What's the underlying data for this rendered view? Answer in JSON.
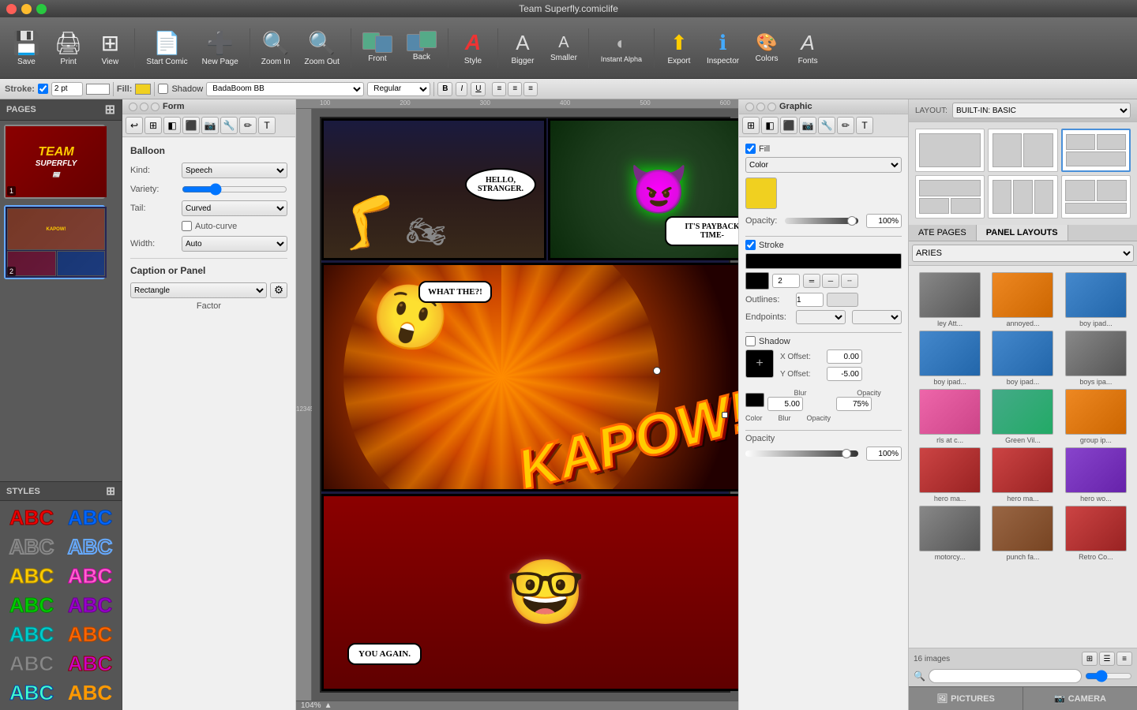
{
  "window": {
    "title": "Team Superfly.comiclife",
    "close": "×",
    "minimize": "−",
    "maximize": "+"
  },
  "toolbar": {
    "save_label": "Save",
    "print_label": "Print",
    "view_label": "View",
    "start_comic_label": "Start Comic",
    "new_page_label": "New Page",
    "zoom_in_label": "Zoom In",
    "zoom_out_label": "Zoom Out",
    "front_label": "Front",
    "back_label": "Back",
    "style_label": "Style",
    "bigger_label": "Bigger",
    "smaller_label": "Smaller",
    "instant_alpha_label": "Instant Alpha",
    "export_label": "Export",
    "inspector_label": "Inspector",
    "colors_label": "Colors",
    "fonts_label": "Fonts"
  },
  "format_bar": {
    "stroke_label": "Stroke:",
    "stroke_width": "2",
    "fill_label": "Fill:",
    "shadow_label": "Shadow",
    "font_family": "BadaBoom BB",
    "font_style": "Regular",
    "bold": "B",
    "italic": "I",
    "underline": "U"
  },
  "pages_panel": {
    "title": "PAGES",
    "pages": [
      {
        "num": "1",
        "thumb_color": "#8B0000"
      },
      {
        "num": "2",
        "thumb_color": "#2F4F8F"
      }
    ]
  },
  "styles_panel": {
    "title": "STYLES",
    "styles": [
      {
        "text": "ABC",
        "style": "red",
        "text2": "ABC",
        "style2": "blue"
      },
      {
        "text": "ABC",
        "style": "outline",
        "text2": "ABC",
        "style2": "outline2"
      },
      {
        "text": "ABC",
        "style": "yellow",
        "text2": "ABC",
        "style2": "pink"
      },
      {
        "text": "ABC",
        "style": "green",
        "text2": "ABC",
        "style2": "purple"
      },
      {
        "text": "ABC",
        "style": "teal",
        "text2": "ABC",
        "style2": "orange"
      },
      {
        "text": "ABC",
        "style": "gray",
        "text2": "ABC",
        "style2": "gradient"
      },
      {
        "text": "ABC",
        "style": "red",
        "text2": "ABC",
        "style2": "blue"
      }
    ]
  },
  "form_panel": {
    "title": "Form",
    "balloon_section": "Balloon",
    "kind_label": "Kind:",
    "kind_value": "Speech",
    "variety_label": "Variety:",
    "tail_label": "Tail:",
    "tail_value": "Curved",
    "auto_curve_label": "Auto-curve",
    "width_label": "Width:",
    "width_value": "Auto",
    "caption_section": "Caption or Panel",
    "caption_value": "Rectangle",
    "factor_label": "Factor"
  },
  "graphic_panel": {
    "title": "Graphic",
    "fill_label": "Fill",
    "fill_type": "Color",
    "opacity_label": "Opacity:",
    "opacity_value": "100%",
    "stroke_label": "Stroke",
    "outlines_label": "Outlines:",
    "outlines_value": "1",
    "stroke_width": "2",
    "endpoints_label": "Endpoints:",
    "shadow_label": "Shadow",
    "x_offset_label": "X Offset:",
    "x_offset_value": "0.00",
    "y_offset_label": "Y Offset:",
    "y_offset_value": "-5.00",
    "blur_label": "Blur",
    "blur_value": "5.00",
    "shadow_opacity_label": "Opacity",
    "shadow_opacity_value": "75%",
    "opacity_section_label": "Opacity",
    "opacity_section_value": "100%"
  },
  "layout_panel": {
    "title": "LAYOUT:",
    "value": "BUILT-IN: BASIC",
    "tabs": [
      "ATE PAGES",
      "PANEL LAYOUTS"
    ],
    "dropdown_label": "ARIES"
  },
  "photo_library": {
    "count": "16 images",
    "search_placeholder": "",
    "items": [
      {
        "label": "ley Att...",
        "color": "pt-gray"
      },
      {
        "label": "annoyed...",
        "color": "pt-orange"
      },
      {
        "label": "boy ipad...",
        "color": "pt-blue"
      },
      {
        "label": "boy ipad...",
        "color": "pt-blue"
      },
      {
        "label": "boy ipad...",
        "color": "pt-blue"
      },
      {
        "label": "boys ipa...",
        "color": "pt-gray"
      },
      {
        "label": "rls at c...",
        "color": "pt-pink"
      },
      {
        "label": "Green Vil...",
        "color": "pt-green"
      },
      {
        "label": "group ip...",
        "color": "pt-orange"
      },
      {
        "label": "hero ma...",
        "color": "pt-red"
      },
      {
        "label": "hero ma...",
        "color": "pt-red"
      },
      {
        "label": "hero wo...",
        "color": "pt-purple"
      },
      {
        "label": "motorcy...",
        "color": "pt-gray"
      },
      {
        "label": "punch fa...",
        "color": "pt-brown"
      },
      {
        "label": "Retro Co...",
        "color": "pt-red"
      }
    ]
  },
  "bottom": {
    "camera_label": "CAMERA",
    "pictures_label": "PICTURES",
    "zoom": "104%"
  },
  "comic": {
    "bubble1": "HELLO, STRANGER.",
    "bubble2": "IT'S PAYBACK TIME-",
    "bubble3": "WHAT THE?!",
    "bubble4": "YOU AGAIN.",
    "kapow": "KAPOW!"
  }
}
